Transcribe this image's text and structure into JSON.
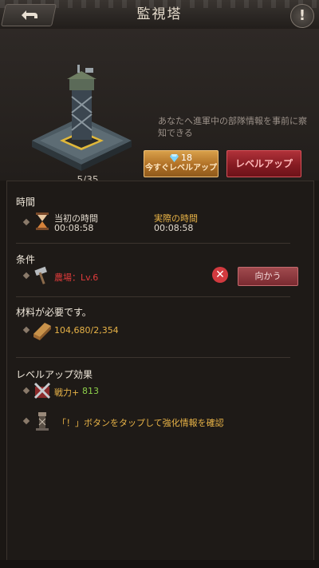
{
  "header": {
    "title": "監視塔",
    "back_icon": "back-arrow-icon",
    "help_label": "!"
  },
  "building": {
    "count": "5/35",
    "description": "あなたへ進軍中の部隊情報を事前に察知できる"
  },
  "actions": {
    "instant_cost": "18",
    "instant_label": "今すぐレベルアップ",
    "levelup_label": "レベルアップ"
  },
  "time": {
    "title": "時間",
    "original_label": "当初の時間",
    "original_value": "00:08:58",
    "actual_label": "実際の時間",
    "actual_value": "00:08:58"
  },
  "conditions": {
    "title": "条件",
    "requirement": "農場：Lv.6",
    "goto_label": "向かう"
  },
  "materials": {
    "title": "材料が必要です。",
    "wood": "104,680/2,354"
  },
  "effects": {
    "title": "レベルアップ効果",
    "power_label": "戦力+",
    "power_value": "813",
    "info": "「！」ボタンをタップして強化情報を確認"
  },
  "colors": {
    "accent_gold": "#e8b347",
    "danger_red": "#e03b3b",
    "positive_green": "#8ed04b"
  }
}
